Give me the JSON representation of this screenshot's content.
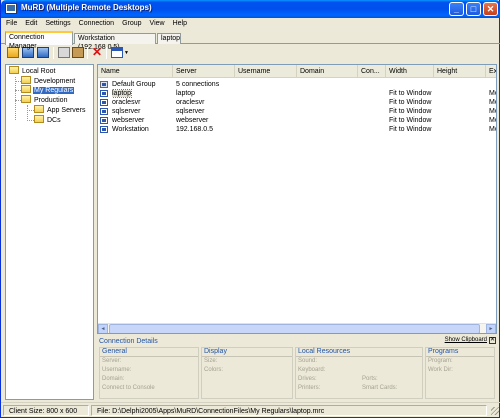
{
  "window": {
    "title": "MuRD (Multiple Remote Desktops)",
    "controls": {
      "minimize": "_",
      "maximize": "□",
      "close": "✕"
    }
  },
  "menu": [
    "File",
    "Edit",
    "Settings",
    "Connection",
    "Group",
    "View",
    "Help"
  ],
  "tabs": [
    {
      "label": "Connection Manager",
      "active": true
    },
    {
      "label": "Workstation (192.168.0.5)",
      "active": false
    },
    {
      "label": "laptop",
      "active": false
    }
  ],
  "toolbar": {
    "icons": [
      "new-group-icon",
      "open-group-icon",
      "new-connection-icon",
      "copy-icon",
      "paste-icon",
      "delete-icon",
      "view-icon"
    ],
    "delete_glyph": "✕",
    "dropdown_glyph": "▼"
  },
  "tree": {
    "root": "Local Root",
    "nodes": [
      {
        "label": "Development",
        "level": 1
      },
      {
        "label": "My Regulars",
        "level": 1,
        "selected": true
      },
      {
        "label": "Production",
        "level": 1
      },
      {
        "label": "App Servers",
        "level": 2
      },
      {
        "label": "DCs",
        "level": 2
      }
    ]
  },
  "list": {
    "columns": [
      "Name",
      "Server",
      "Username",
      "Domain",
      "Con...",
      "Width",
      "Height",
      "Ex"
    ],
    "rows": [
      {
        "name": "Default Group",
        "server": "5 connections",
        "username": "",
        "domain": "",
        "con": "",
        "width": "",
        "height": "",
        "ex": "",
        "type": "group"
      },
      {
        "name": "laptop",
        "server": "laptop",
        "username": "",
        "domain": "",
        "con": "",
        "width": "Fit to Window",
        "height": "",
        "ex": "Mo",
        "selected": true
      },
      {
        "name": "oraclesvr",
        "server": "oraclesvr",
        "username": "",
        "domain": "",
        "con": "",
        "width": "Fit to Window",
        "height": "",
        "ex": "Mo"
      },
      {
        "name": "sqlserver",
        "server": "sqlserver",
        "username": "",
        "domain": "",
        "con": "",
        "width": "Fit to Window",
        "height": "",
        "ex": "Mo"
      },
      {
        "name": "webserver",
        "server": "webserver",
        "username": "",
        "domain": "",
        "con": "",
        "width": "Fit to Window",
        "height": "",
        "ex": "Mo"
      },
      {
        "name": "Workstation",
        "server": "192.168.0.5",
        "username": "",
        "domain": "",
        "con": "",
        "width": "Fit to Window",
        "height": "",
        "ex": "Mo"
      }
    ],
    "scroll_left": "◄",
    "scroll_right": "►"
  },
  "details": {
    "title": "Connection Details",
    "show_clipboard": "Show Clipboard",
    "close": "✕",
    "groups": [
      {
        "title": "General",
        "fields": [
          "Server:",
          "Username:",
          "Domain:",
          "Connect to Console"
        ]
      },
      {
        "title": "Display",
        "fields": [
          "Size:",
          "Colors:"
        ]
      },
      {
        "title": "Local Resources",
        "fields": [
          "Sound:",
          "Keyboard:",
          "Drives:",
          "Printers:"
        ],
        "fields2": [
          "Ports:",
          "Smart Cards:"
        ]
      },
      {
        "title": "Programs",
        "fields": [
          "Program:",
          "Work Dir:"
        ]
      }
    ]
  },
  "status": {
    "client_size": "Client Size: 800 x 600",
    "file": "File: D:\\Delphi2005\\Apps\\MuRD\\ConnectionFiles\\My Regulars\\laptop.mrc"
  }
}
